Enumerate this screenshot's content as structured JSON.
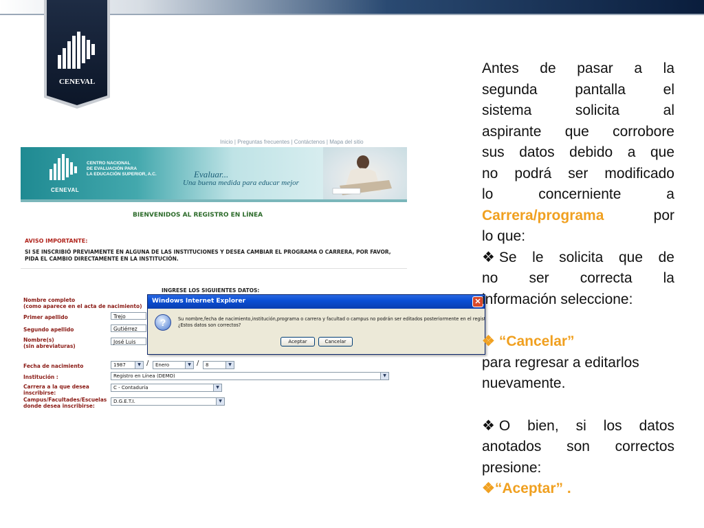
{
  "brand": {
    "logo_text": "CENEVAL"
  },
  "screenshot": {
    "top_links": "Inicio | Preguntas frecuentes | Contáctenos | Mapa del sitio",
    "banner": {
      "institution": [
        "CENTRO NACIONAL",
        "DE EVALUACIÓN PARA",
        "LA EDUCACIÓN SUPERIOR, A.C."
      ],
      "logo_text": "CENEVAL",
      "slogan_title": "Evaluar...",
      "slogan": "Una buena medida para educar mejor"
    },
    "welcome": "BIENVENIDOS AL REGISTRO EN LÍNEA",
    "aviso_title": "AVISO IMPORTANTE:",
    "aviso_text": "SI SE INSCRIBIÓ PREVIAMENTE EN ALGUNA DE LAS INSTITUCIONES Y DESEA CAMBIAR EL PROGRAMA O CARRERA, POR FAVOR, PIDA EL CAMBIO DIRECTAMENTE EN LA INSTITUCIÓN.",
    "ingrese": "INGRESE LOS SIGUIENTES DATOS:",
    "form": {
      "nombre_completo_label": "Nombre completo",
      "nombre_completo_sub": "(como aparece en el acta de nacimiento)",
      "primer_apellido_label": "Primer apellido",
      "primer_apellido_value": "Trejo",
      "segundo_apellido_label": "Segundo apellido",
      "segundo_apellido_value": "Gutiérrez",
      "nombres_label": "Nombre(s)",
      "nombres_sub": "(sin abreviaturas)",
      "nombres_value": "José Luis",
      "fecha_label": "Fecha de nacimiento",
      "fecha_year": "1987",
      "fecha_month": "Enero",
      "fecha_day": "8",
      "institucion_label": "Institución :",
      "institucion_value": "Registro en Línea (DEMO)",
      "carrera_label": [
        "Carrera a la que desea",
        "inscribirse:"
      ],
      "carrera_value": "C - Contaduría",
      "campus_label": [
        "Campus/Facultades/Escuelas",
        "donde desea inscribirse:"
      ],
      "campus_value": "D.G.E.T.I."
    },
    "dialog": {
      "title": "Windows Internet Explorer",
      "message_line1": "Su nombre,fecha de nacimiento,institución,programa o carrera y facultad o campus no podrán ser editados posteriormente en el registro",
      "message_line2": "¿Estos datos son correctos?",
      "accept": "Aceptar",
      "cancel": "Cancelar"
    }
  },
  "content": {
    "para1_lines": [
      "Antes de pasar a la",
      "segunda pantalla el",
      "sistema solicita al",
      "aspirante que corrobore",
      "sus datos debido a que",
      "no podrá ser modificado",
      "lo concerniente a"
    ],
    "para1_highlight": "Carrera/programa",
    "para1_por": "por",
    "para1_last": "lo que:",
    "bullet1_first": "Se le solicita que de",
    "bullet1_lines": [
      "no ser correcta la",
      "información seleccione:"
    ],
    "cancelar_label": "“Cancelar”",
    "cancelar_desc_lines": [
      "para regresar a editarlos",
      "nuevamente."
    ],
    "bullet2_first": "O bien, si los datos",
    "bullet2_lines": [
      "anotados son correctos",
      "presione:"
    ],
    "aceptar_label": "“Aceptar” ."
  },
  "colors": {
    "highlight": "#f0a020",
    "navy": "#0a1d3c",
    "dialog_title": "#0a4fd6"
  }
}
